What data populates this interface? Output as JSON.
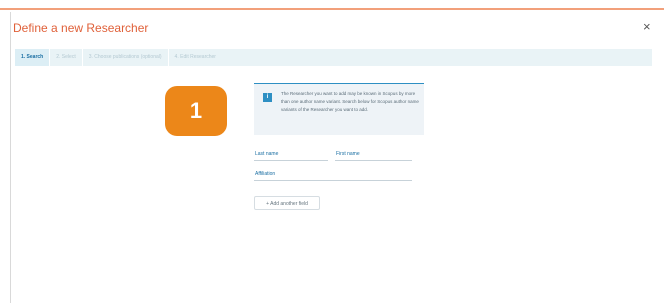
{
  "dialog": {
    "title": "Define a new Researcher",
    "close_glyph": "×"
  },
  "steps": [
    {
      "label": "1. Search",
      "active": true
    },
    {
      "label": "2. Select",
      "active": false
    },
    {
      "label": "3. Choose publications (optional)",
      "active": false
    },
    {
      "label": "4. Edit Researcher",
      "active": false
    }
  ],
  "callout": {
    "number": "1",
    "color": "#ec8719"
  },
  "info": {
    "icon": "info-icon",
    "icon_glyph": "i",
    "text": "The Researcher you want to add may be known in Scopus by more than one author name variant. Search below for Scopus author name variants of the Researcher you want to add."
  },
  "form": {
    "last_name_label": "Last name",
    "first_name_label": "First name",
    "affiliation_label": "Affiliation",
    "add_field_label": "+ Add another field"
  },
  "colors": {
    "title": "#e0613a",
    "accent_blue": "#2e8fc3",
    "link_blue": "#1b6fa3"
  }
}
